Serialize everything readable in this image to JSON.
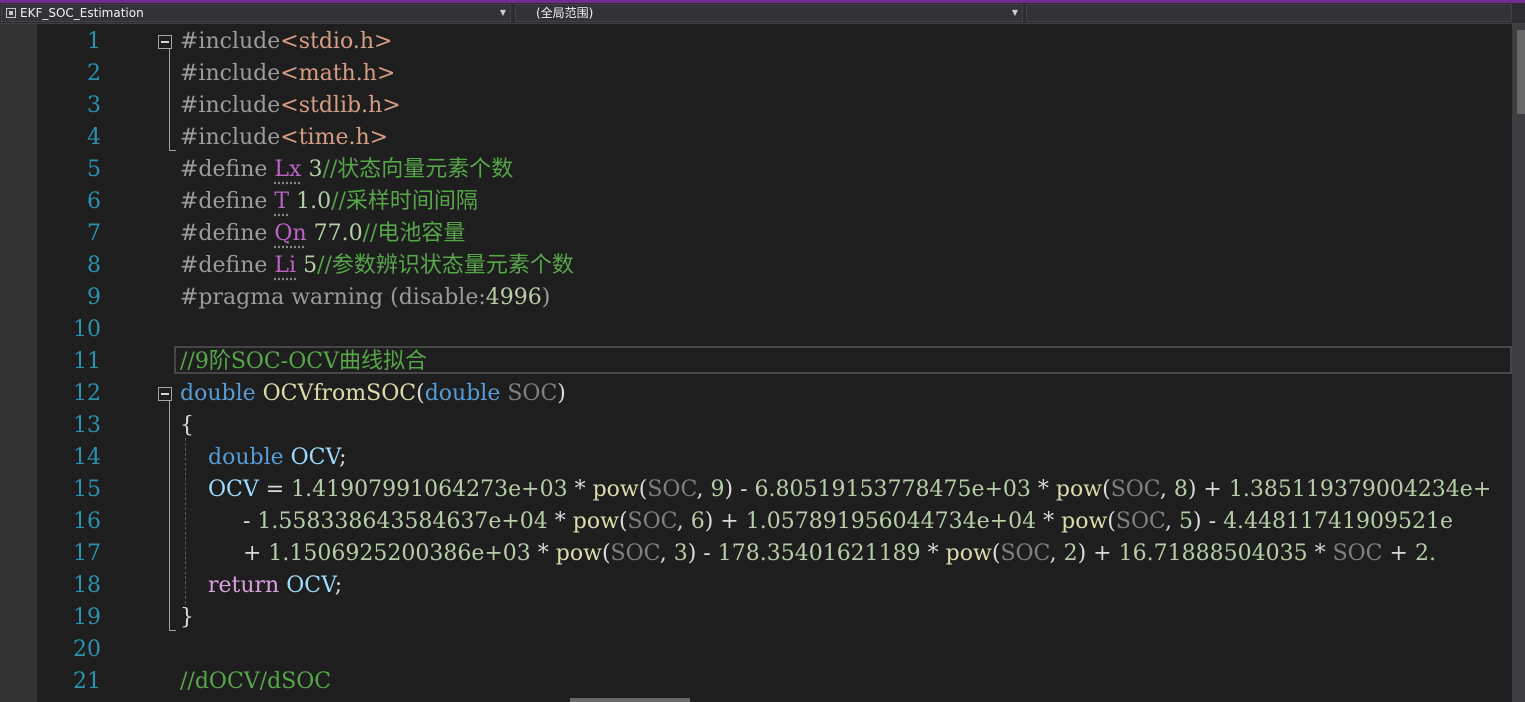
{
  "navbar": {
    "project": "EKF_SOC_Estimation",
    "scope": "(全局范围)"
  },
  "line_numbers": [
    "1",
    "2",
    "3",
    "4",
    "5",
    "6",
    "7",
    "8",
    "9",
    "10",
    "11",
    "12",
    "13",
    "14",
    "15",
    "16",
    "17",
    "18",
    "19",
    "20",
    "21"
  ],
  "code": {
    "include_kw": "#include",
    "include_stdio": "<stdio.h>",
    "include_math": "<math.h>",
    "include_stdlib": "<stdlib.h>",
    "include_time": "<time.h>",
    "define_kw": "#define",
    "lx_name": "Lx",
    "lx_value": "3",
    "lx_comment": "//状态向量元素个数",
    "t_name": "T",
    "t_value": "1.0",
    "t_comment": "//采样时间间隔",
    "qn_name": "Qn",
    "qn_value": "77.0",
    "qn_comment": "//电池容量",
    "li_name": "Li",
    "li_value": "5",
    "li_comment": "//参数辨识状态量元素个数",
    "pragma_text": "#pragma warning (disable:",
    "pragma_value": "4996",
    "pragma_close": ")",
    "line11_comment": "//9阶SOC-OCV曲线拟合",
    "type_double": "double",
    "func_name": "OCVfromSOC",
    "open_paren": "(",
    "param_name": "SOC",
    "close_paren": ")",
    "open_brace": "{",
    "close_brace": "}",
    "var_ocv": "OCV",
    "semicolon": ";",
    "assign": " = ",
    "l15_c1": "1.41907991064273e+03",
    "l15_c2": "6.80519153778475e+03",
    "l15_c3": "1.385119379004234e+",
    "l16_c1": "1.558338643584637e+04",
    "l16_c2": "1.057891956044734e+04",
    "l16_c3": "4.44811741909521e",
    "l17_c1": "1.1506925200386e+03",
    "l17_c2": "178.35401621189",
    "l17_c3": "16.71888504035",
    "l17_c4": "2.",
    "pow_fn": "pow",
    "exp_9": "9",
    "exp_8": "8",
    "exp_6": "6",
    "exp_5": "5",
    "exp_3": "3",
    "exp_2": "2",
    "op_times": " * ",
    "op_plus": " + ",
    "op_minus": " - ",
    "comma": ", ",
    "return_kw": "return",
    "line21_comment": "//dOCV/dSOC"
  }
}
